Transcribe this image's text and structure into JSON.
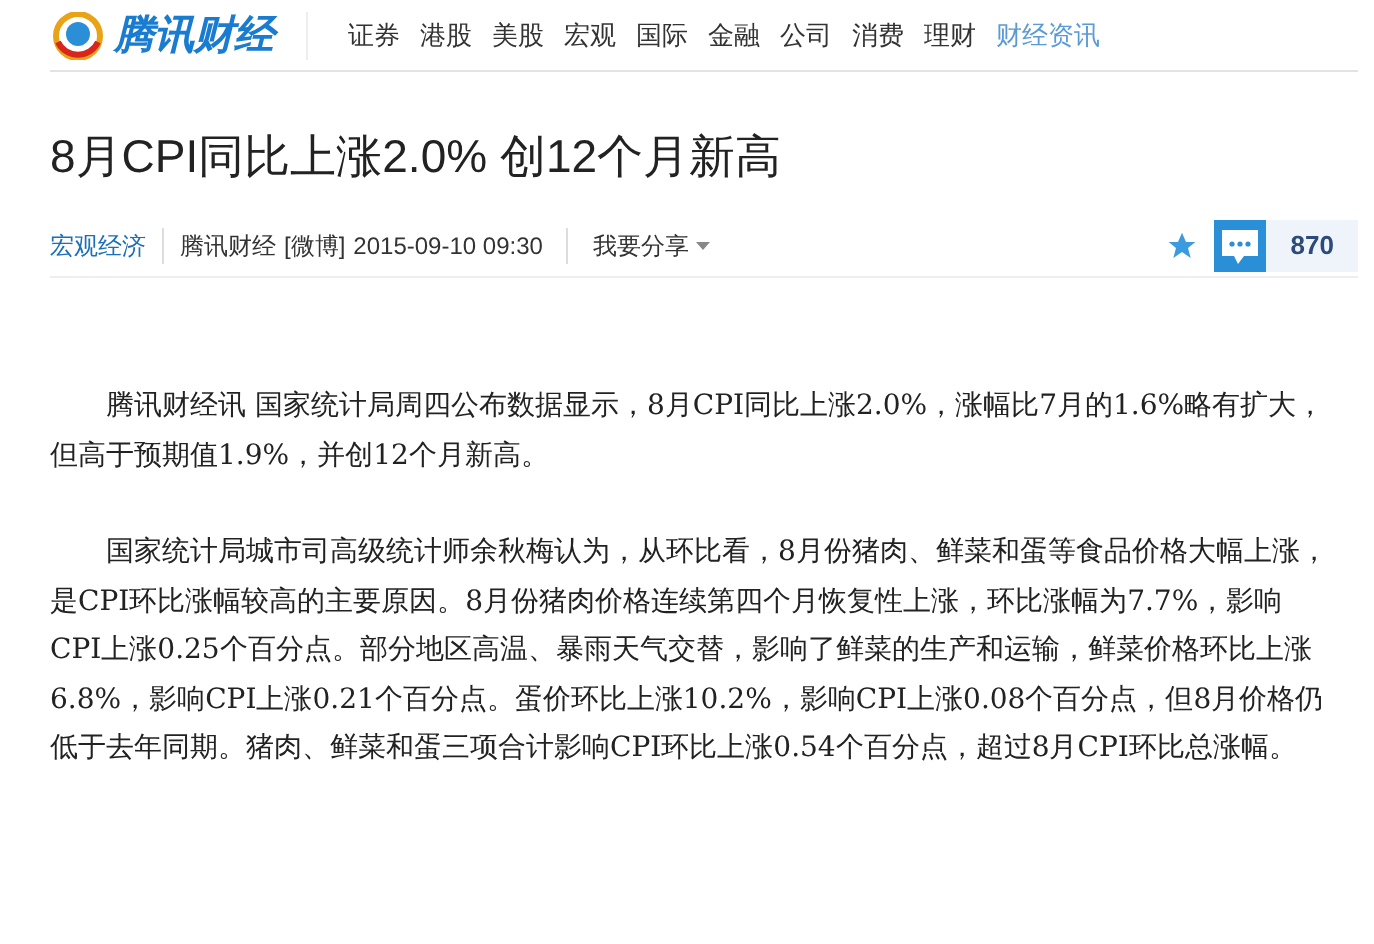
{
  "header": {
    "logo": "腾讯财经",
    "nav": [
      {
        "label": "证券",
        "selected": false
      },
      {
        "label": "港股",
        "selected": false
      },
      {
        "label": "美股",
        "selected": false
      },
      {
        "label": "宏观",
        "selected": false
      },
      {
        "label": "国际",
        "selected": false
      },
      {
        "label": "金融",
        "selected": false
      },
      {
        "label": "公司",
        "selected": false
      },
      {
        "label": "消费",
        "selected": false
      },
      {
        "label": "理财",
        "selected": false
      },
      {
        "label": "财经资讯",
        "selected": true
      }
    ]
  },
  "article": {
    "title": "8月CPI同比上涨2.0% 创12个月新高",
    "meta": {
      "category": "宏观经济",
      "source": "腾讯财经",
      "weibo": "[微博]",
      "time": "2015-09-10 09:30",
      "share": "我要分享",
      "comment_count": "870"
    },
    "paragraphs": [
      "腾讯财经讯 国家统计局周四公布数据显示，8月CPI同比上涨2.0%，涨幅比7月的1.6%略有扩大，但高于预期值1.9%，并创12个月新高。",
      "国家统计局城市司高级统计师余秋梅认为，从环比看，8月份猪肉、鲜菜和蛋等食品价格大幅上涨，是CPI环比涨幅较高的主要原因。8月份猪肉价格连续第四个月恢复性上涨，环比涨幅为7.7%，影响CPI上涨0.25个百分点。部分地区高温、暴雨天气交替，影响了鲜菜的生产和运输，鲜菜价格环比上涨6.8%，影响CPI上涨0.21个百分点。蛋价环比上涨10.2%，影响CPI上涨0.08个百分点，但8月价格仍低于去年同期。猪肉、鲜菜和蛋三项合计影响CPI环比上涨0.54个百分点，超过8月CPI环比总涨幅。"
    ]
  }
}
